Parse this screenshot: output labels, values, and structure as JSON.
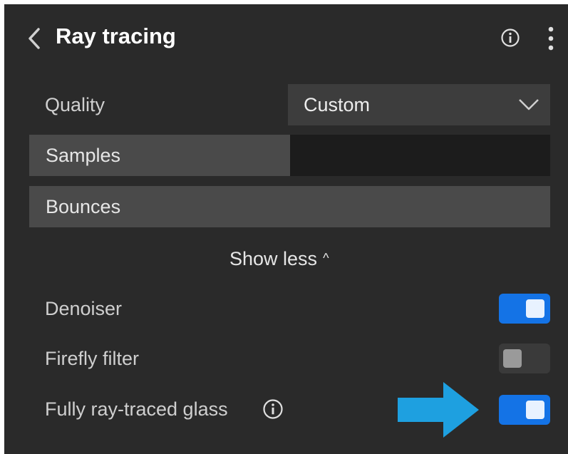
{
  "header": {
    "title": "Ray tracing",
    "back_icon": "chevron-left-icon",
    "info_icon": "info-icon",
    "menu_icon": "kebab-menu-icon"
  },
  "quality": {
    "label": "Quality",
    "selected": "Custom"
  },
  "samples": {
    "label": "Samples",
    "fill_fraction": 0.5
  },
  "bounces": {
    "label": "Bounces",
    "fill_fraction": 1.0
  },
  "show_less": {
    "label": "Show less",
    "caret": "^"
  },
  "toggles": [
    {
      "label": "Denoiser",
      "on": true
    },
    {
      "label": "Firefly filter",
      "on": false
    },
    {
      "label": "Fully ray-traced glass",
      "on": true,
      "info_icon": "info-icon"
    }
  ],
  "annotation": {
    "icon": "arrow-right-icon",
    "color": "#1ea0e0"
  },
  "colors": {
    "panel_bg": "#2a2a2a",
    "accent": "#1473e6"
  }
}
